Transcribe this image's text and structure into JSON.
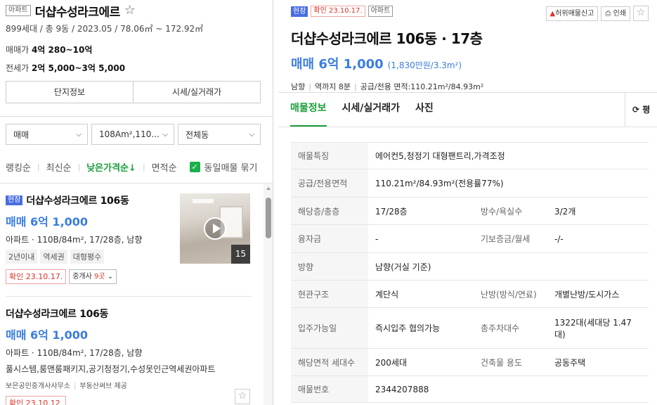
{
  "complex": {
    "type_badge": "아파트",
    "name": "더샵수성라크에르",
    "star": "☆",
    "summary": "899세대 / 총 9동 / 2023.05 / 78.06㎡ ~ 172.92㎡",
    "sale_label": "매매가",
    "sale_range": "4억 280~10억",
    "jeonse_label": "전세가",
    "jeonse_range": "2억 5,000~3억 5,000",
    "tabs": [
      "단지정보",
      "시세/실거래가"
    ]
  },
  "filters": [
    {
      "label": "매매"
    },
    {
      "label": "108Am²,110..."
    },
    {
      "label": "전체동"
    }
  ],
  "sort": {
    "options": [
      "랭킹순",
      "최신순",
      "낮은가격순",
      "면적순"
    ],
    "active_arrow": "↓",
    "group_label": "동일매물 묶기"
  },
  "listings": [
    {
      "site_badge": "현장",
      "title": "더샵수성라크에르 106동",
      "price": "매매 6억 1,000",
      "spec": "아파트 · 110B/84m², 17/28층, 남향",
      "tags": [
        "2년이내",
        "역세권",
        "대형평수"
      ],
      "confirm": "확인 23.10.17.",
      "agent_btn": "중개사",
      "agent_count": "9곳",
      "photo_count": "15"
    },
    {
      "title": "더샵수성라크에르 106동",
      "price": "매매 6억 1,000",
      "spec": "아파트 · 110B/84m², 17/28층, 남향",
      "desc": "풀시스템,룸앤룸패키지,공기청정기,수성못인근역세권아파트",
      "agent": "보은공인중개사사무소",
      "provider": "부동산써브 제공",
      "confirm": "확인 23.10.12."
    }
  ],
  "detail": {
    "site_badge": "현장",
    "confirm": "확인 23.10.17.",
    "type_badge": "아파트",
    "title": "더샵수성라크에르 106동 · 17층",
    "price": "매매 6억 1,000",
    "unit_price": "(1,830만원/3.3m²)",
    "meta": [
      "남향",
      "역까지 8분",
      "공급/전용 면적:110.21m²/84.93m²"
    ],
    "tools": {
      "report": "허위매물신고",
      "print": "인쇄"
    },
    "tabs": [
      "매물정보",
      "시세/실거래가",
      "사진"
    ],
    "tab_right": "평",
    "rows": [
      {
        "k": "매물특징",
        "v": "에어컨5,청정기 대형팬트리,가격조정"
      },
      {
        "k": "공급/전용면적",
        "v": "110.21m²/84.93m²(전용률77%)"
      },
      {
        "k": "해당층/총층",
        "v": "17/28층",
        "k2": "방수/욕실수",
        "v2": "3/2개"
      },
      {
        "k": "융자금",
        "v": "-",
        "k2": "기보증금/월세",
        "v2": "-/-"
      },
      {
        "k": "방향",
        "v": "남향(거실 기준)"
      },
      {
        "k": "현관구조",
        "v": "계단식",
        "k2": "난방(방식/연료)",
        "v2": "개별난방/도시가스"
      },
      {
        "k": "입주가능일",
        "v": "즉시입주 협의가능",
        "k2": "총주차대수",
        "v2": "1322대(세대당 1.47대)"
      },
      {
        "k": "해당면적 세대수",
        "v": "200세대",
        "k2": "건축물 용도",
        "v2": "공동주택"
      },
      {
        "k": "매물번호",
        "v": "2344207888"
      }
    ]
  },
  "colors": {
    "accent_green": "#1a9e3c",
    "price_blue": "#3b7de0",
    "confirm_red": "#d9342b",
    "site_blue": "#4a6ee0"
  }
}
